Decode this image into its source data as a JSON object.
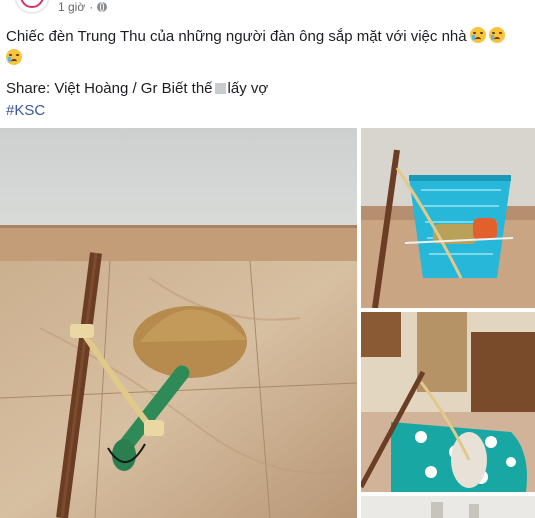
{
  "post": {
    "time": "1 giờ",
    "separator": "·",
    "visibility_icon": "globe-icon",
    "text_line1": "Chiếc đèn Trung Thu của những người đàn ông sắp mặt với việc nhà",
    "emoji_name": "crying-face-icon",
    "share_prefix": "Share: Việt Hoàng / Gr Biết thế",
    "share_suffix": "lấy vợ",
    "hashtag": "#KSC"
  },
  "colors": {
    "text": "#1c1e21",
    "meta": "#65676b",
    "link": "#385898",
    "wall": "#cfd2d1",
    "floor": "#c4a88b",
    "broom_handle": "#6b3d24",
    "broom_bristle": "#b78d4f",
    "broom_green": "#2e8b57",
    "basket": "#27b7d8",
    "iron_board": "#19a7a3"
  }
}
